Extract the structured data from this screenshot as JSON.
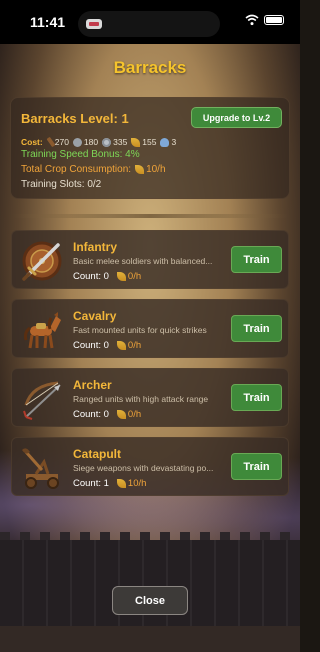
{
  "status_bar": {
    "time": "11:41"
  },
  "page": {
    "title": "Barracks"
  },
  "barracks": {
    "level_text": "Barracks Level: 1",
    "upgrade_label": "Upgrade to Lv.2",
    "cost_label": "Cost:",
    "costs": [
      {
        "icon": "wood-icon",
        "value": "270"
      },
      {
        "icon": "stone-icon",
        "value": "180"
      },
      {
        "icon": "iron-icon",
        "value": "335"
      },
      {
        "icon": "crop-icon",
        "value": "155"
      },
      {
        "icon": "population-icon",
        "value": "3"
      }
    ],
    "speed_bonus": "Training Speed Bonus: 4%",
    "crop_consumption_label": "Total Crop Consumption:",
    "crop_consumption_value": "10/h",
    "training_slots": "Training Slots: 0/2"
  },
  "units": [
    {
      "name": "Infantry",
      "icon": "sword-shield-icon",
      "description": "Basic melee soldiers with balanced...",
      "count": "Count: 0",
      "rate": "0/h",
      "train_label": "Train"
    },
    {
      "name": "Cavalry",
      "icon": "horse-icon",
      "description": "Fast mounted units for quick strikes",
      "count": "Count: 0",
      "rate": "0/h",
      "train_label": "Train"
    },
    {
      "name": "Archer",
      "icon": "bow-arrow-icon",
      "description": "Ranged units with high attack range",
      "count": "Count: 0",
      "rate": "0/h",
      "train_label": "Train"
    },
    {
      "name": "Catapult",
      "icon": "catapult-icon",
      "description": "Siege weapons with devastating po...",
      "count": "Count: 1",
      "rate": "10/h",
      "train_label": "Train"
    }
  ],
  "footer": {
    "close_label": "Close"
  },
  "colors": {
    "accent_gold": "#f3b73a",
    "button_green": "#3f8a3a",
    "speed_green": "#7ed857",
    "crop_orange": "#f0a43a"
  }
}
